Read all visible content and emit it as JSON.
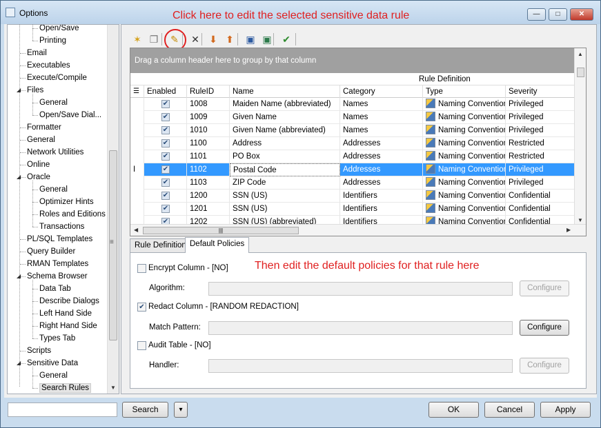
{
  "window": {
    "title": "Options",
    "minimize": "—",
    "maximize": "□",
    "close": "✕"
  },
  "annotations": {
    "top": "Click here to edit the selected sensitive data rule",
    "middle": "Then edit the default policies for that rule here"
  },
  "tree": {
    "items": [
      {
        "label": "Open/Save",
        "level": 2
      },
      {
        "label": "Printing",
        "level": 2
      },
      {
        "label": "Email",
        "level": 1
      },
      {
        "label": "Executables",
        "level": 1
      },
      {
        "label": "Execute/Compile",
        "level": 1
      },
      {
        "label": "Files",
        "level": 1,
        "expanded": true
      },
      {
        "label": "General",
        "level": 2
      },
      {
        "label": "Open/Save Dial...",
        "level": 2
      },
      {
        "label": "Formatter",
        "level": 1
      },
      {
        "label": "General",
        "level": 1
      },
      {
        "label": "Network Utilities",
        "level": 1
      },
      {
        "label": "Online",
        "level": 1
      },
      {
        "label": "Oracle",
        "level": 1,
        "expanded": true
      },
      {
        "label": "General",
        "level": 2
      },
      {
        "label": "Optimizer Hints",
        "level": 2
      },
      {
        "label": "Roles and Editions",
        "level": 2
      },
      {
        "label": "Transactions",
        "level": 2
      },
      {
        "label": "PL/SQL Templates",
        "level": 1
      },
      {
        "label": "Query Builder",
        "level": 1
      },
      {
        "label": "RMAN Templates",
        "level": 1
      },
      {
        "label": "Schema Browser",
        "level": 1,
        "expanded": true
      },
      {
        "label": "Data Tab",
        "level": 2
      },
      {
        "label": "Describe Dialogs",
        "level": 2
      },
      {
        "label": "Left Hand Side",
        "level": 2
      },
      {
        "label": "Right Hand Side",
        "level": 2
      },
      {
        "label": "Types Tab",
        "level": 2
      },
      {
        "label": "Scripts",
        "level": 1
      },
      {
        "label": "Sensitive Data",
        "level": 1,
        "expanded": true
      },
      {
        "label": "General",
        "level": 2
      },
      {
        "label": "Search Rules",
        "level": 2,
        "selected": true
      }
    ]
  },
  "toolbar": {
    "buttons": [
      "new-icon",
      "copy-icon",
      "edit-pencil-icon",
      "delete-icon",
      "import-icon",
      "export-icon",
      "save-icon",
      "save-as-icon",
      "apply-check-icon"
    ]
  },
  "grid": {
    "group_hint": "Drag a column header here to group by that column",
    "band_label": "Rule Definition",
    "headers": [
      "Enabled",
      "RuleID",
      "Name",
      "Category",
      "Type",
      "Severity"
    ],
    "rows": [
      {
        "enabled": true,
        "id": "1008",
        "name": "Maiden Name (abbreviated)",
        "category": "Names",
        "type": "Naming Convention",
        "severity": "Privileged"
      },
      {
        "enabled": true,
        "id": "1009",
        "name": "Given Name",
        "category": "Names",
        "type": "Naming Convention",
        "severity": "Privileged"
      },
      {
        "enabled": true,
        "id": "1010",
        "name": "Given Name (abbreviated)",
        "category": "Names",
        "type": "Naming Convention",
        "severity": "Privileged"
      },
      {
        "enabled": true,
        "id": "1100",
        "name": "Address",
        "category": "Addresses",
        "type": "Naming Convention",
        "severity": "Restricted"
      },
      {
        "enabled": true,
        "id": "1101",
        "name": "PO Box",
        "category": "Addresses",
        "type": "Naming Convention",
        "severity": "Restricted"
      },
      {
        "enabled": true,
        "id": "1102",
        "name": "Postal Code",
        "category": "Addresses",
        "type": "Naming Convention",
        "severity": "Privileged",
        "selected": true
      },
      {
        "enabled": true,
        "id": "1103",
        "name": "ZIP Code",
        "category": "Addresses",
        "type": "Naming Convention",
        "severity": "Privileged"
      },
      {
        "enabled": true,
        "id": "1200",
        "name": "SSN (US)",
        "category": "Identifiers",
        "type": "Naming Convention",
        "severity": "Confidential"
      },
      {
        "enabled": true,
        "id": "1201",
        "name": "SSN (US)",
        "category": "Identifiers",
        "type": "Naming Convention",
        "severity": "Confidential"
      },
      {
        "enabled": true,
        "id": "1202",
        "name": "SSN (US) (abbreviated)",
        "category": "Identifiers",
        "type": "Naming Convention",
        "severity": "Confidential"
      }
    ]
  },
  "tabs": {
    "rule_definition": "Rule Definition",
    "default_policies": "Default Policies"
  },
  "policies": {
    "encrypt_label": "Encrypt Column - [NO]",
    "encrypt_checked": false,
    "algorithm_label": "Algorithm:",
    "redact_label": "Redact Column - [RANDOM REDACTION]",
    "redact_checked": true,
    "match_label": "Match Pattern:",
    "audit_label": "Audit Table - [NO]",
    "audit_checked": false,
    "handler_label": "Handler:",
    "configure": "Configure"
  },
  "bottom": {
    "search": "Search",
    "dropdown": "▾",
    "ok": "OK",
    "cancel": "Cancel",
    "apply": "Apply"
  }
}
